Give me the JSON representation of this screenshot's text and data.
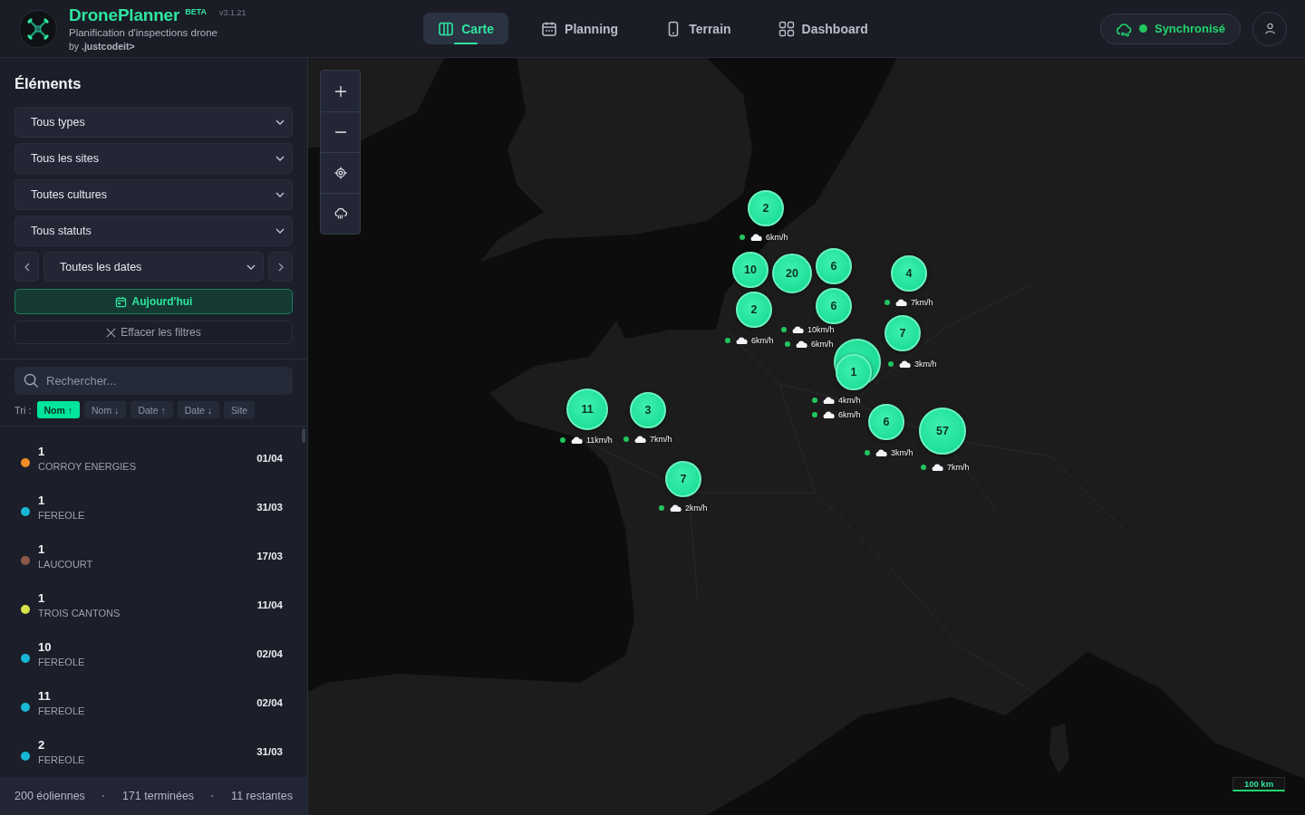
{
  "header": {
    "title": "DronePlanner",
    "badge": "BETA",
    "version": "v3.1.21",
    "subtitle": "Planification d'inspections drone",
    "credit": "by **.justcodeit>**"
  },
  "nav_tabs": [
    {
      "label": "Carte",
      "selected": true
    },
    {
      "label": "Planning",
      "selected": false
    },
    {
      "label": "Terrain",
      "selected": false
    },
    {
      "label": "Dashboard",
      "selected": false
    }
  ],
  "sync": {
    "label": "Synchronisé",
    "online": true
  },
  "sidebar": {
    "title": "Éléments",
    "filters": [
      "Tous types",
      "Tous les sites",
      "Toutes cultures",
      "Tous statuts"
    ],
    "date_filter": "Toutes les dates",
    "today_button": "Aujourd'hui",
    "clear_button": "Effacer les filtres",
    "search": {
      "placeholder": "Rechercher..."
    },
    "sort_label": "Tri :",
    "sort_options": [
      {
        "label": "Nom ↑",
        "selected": true
      },
      {
        "label": "Nom ↓",
        "selected": false
      },
      {
        "label": "Date ↑",
        "selected": false
      },
      {
        "label": "Date ↓",
        "selected": false
      },
      {
        "label": "Site",
        "selected": false
      }
    ],
    "items": [
      {
        "name": "1",
        "site": "CORROY ENERGIES",
        "date": "01/04",
        "color": "#f28c28"
      },
      {
        "name": "1",
        "site": "FEREOLE",
        "date": "31/03",
        "color": "#17b8d6"
      },
      {
        "name": "1",
        "site": "LAUCOURT",
        "date": "17/03",
        "color": "#8a5a48"
      },
      {
        "name": "1",
        "site": "TROIS CANTONS",
        "date": "11/04",
        "color": "#d6e24a"
      },
      {
        "name": "10",
        "site": "FEREOLE",
        "date": "02/04",
        "color": "#17b8d6"
      },
      {
        "name": "11",
        "site": "FEREOLE",
        "date": "02/04",
        "color": "#17b8d6"
      },
      {
        "name": "2",
        "site": "FEREOLE",
        "date": "31/03",
        "color": "#17b8d6"
      }
    ],
    "footer": [
      {
        "kind": "stat",
        "text": "200 éoliennes"
      },
      {
        "kind": "separator",
        "text": "·"
      },
      {
        "kind": "stat",
        "text": "171 terminées"
      },
      {
        "kind": "separator",
        "text": "·"
      },
      {
        "kind": "stat",
        "text": "11 restantes"
      }
    ]
  },
  "map": {
    "clusters": [
      {
        "count": "2",
        "stacked": false
      },
      {
        "count": "10",
        "stacked": false
      },
      {
        "count": "20",
        "stacked": false
      },
      {
        "count": "6",
        "stacked": false
      },
      {
        "count": "4",
        "stacked": false
      },
      {
        "count": "2",
        "stacked": false
      },
      {
        "count": "6",
        "stacked": false
      },
      {
        "count": "7",
        "stacked": false
      },
      {
        "count": "1",
        "stacked": true
      },
      {
        "count": "11",
        "stacked": false
      },
      {
        "count": "3",
        "stacked": false
      },
      {
        "count": "6",
        "stacked": false
      },
      {
        "count": "57",
        "stacked": false
      },
      {
        "count": "7",
        "stacked": false
      }
    ],
    "wind_labels": [
      {
        "speed": "6km/h"
      },
      {
        "speed": "7km/h"
      },
      {
        "speed": "10km/h"
      },
      {
        "speed": "6km/h"
      },
      {
        "speed": "6km/h"
      },
      {
        "speed": "3km/h"
      },
      {
        "speed": "4km/h"
      },
      {
        "speed": "6km/h"
      },
      {
        "speed": "11km/h"
      },
      {
        "speed": "7km/h"
      },
      {
        "speed": "3km/h"
      },
      {
        "speed": "7km/h"
      },
      {
        "speed": "2km/h"
      }
    ],
    "scale": "100 km"
  }
}
